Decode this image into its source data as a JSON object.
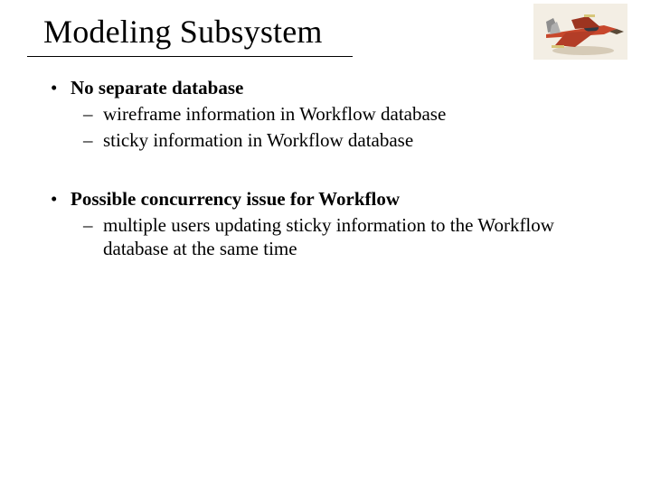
{
  "title": "Modeling Subsystem",
  "bullets": {
    "dot": "•",
    "dash": "–",
    "b1a": "No separate database",
    "b1a_s1": "wireframe information in Workflow database",
    "b1a_s2": "sticky information in Workflow database",
    "b2a": "Possible concurrency issue for Workflow",
    "b2a_s1": "multiple users updating sticky information to the Workflow database at the same time"
  }
}
